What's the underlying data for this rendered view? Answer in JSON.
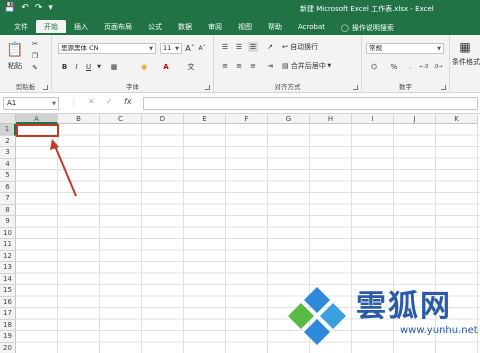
{
  "titlebar": {
    "title": "新建 Microsoft Excel 工作表.xlsx  -  Excel"
  },
  "tabs": [
    "文件",
    "开始",
    "插入",
    "页面布局",
    "公式",
    "数据",
    "审阅",
    "视图",
    "帮助",
    "Acrobat"
  ],
  "tab_search": "操作说明搜索",
  "ribbon": {
    "clipboard": {
      "label": "剪贴板",
      "paste": "粘贴"
    },
    "font": {
      "label": "字体",
      "name": "思源黑体 CN",
      "size": "11",
      "bold": "B",
      "italic": "I",
      "underline": "U"
    },
    "alignment": {
      "label": "对齐方式",
      "wrap": "自动换行",
      "merge": "合并后居中"
    },
    "number": {
      "label": "数字",
      "format": "常规",
      "percent": "%"
    },
    "styles": {
      "conditional": "条件格式"
    }
  },
  "formula_bar": {
    "name_box": "A1",
    "cancel": "✕",
    "enter": "✓",
    "fx": "fx"
  },
  "columns": [
    "A",
    "B",
    "C",
    "D",
    "E",
    "F",
    "G",
    "H",
    "I",
    "J",
    "K"
  ],
  "rows": [
    "1",
    "2",
    "3",
    "4",
    "5",
    "6",
    "7",
    "8",
    "9",
    "10",
    "11",
    "12",
    "13",
    "14",
    "15",
    "16",
    "17",
    "18",
    "19",
    "20"
  ],
  "watermark": {
    "text": "雲狐网",
    "url": "www.yunhu.net"
  },
  "colors": {
    "accent": "#217346",
    "selection": "#c0392b",
    "watermark": "#2a5aa8"
  }
}
